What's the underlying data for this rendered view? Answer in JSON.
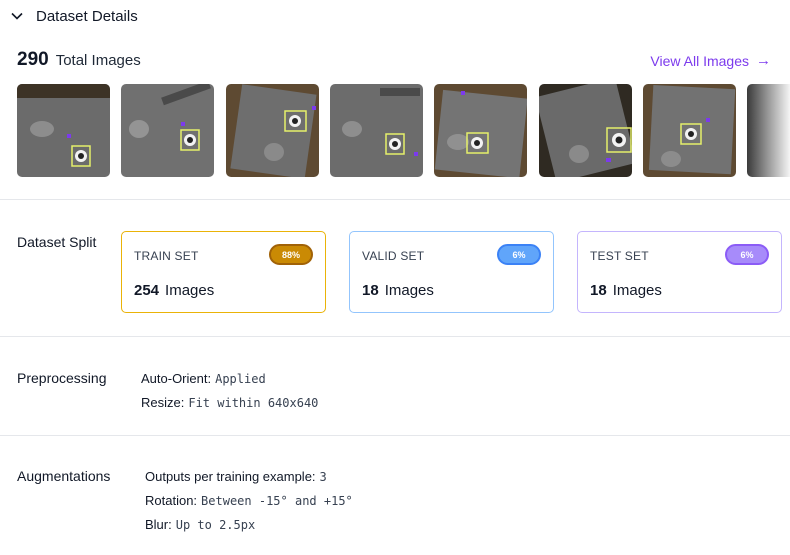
{
  "header": {
    "title": "Dataset Details",
    "icon": "chevron-down-icon"
  },
  "summary": {
    "total_count": "290",
    "total_label": "Total Images",
    "view_all": "View All Images",
    "view_all_arrow": "→"
  },
  "thumbnails": [
    {
      "bg": "#6b6b6b"
    },
    {
      "bg": "#707070"
    },
    {
      "bg": "#6e6e6e"
    },
    {
      "bg": "#6c6c6c"
    },
    {
      "bg": "#747474"
    },
    {
      "bg": "#6a6a6a"
    },
    {
      "bg": "#727272"
    },
    {
      "bg": "#8a8a8a"
    }
  ],
  "split": {
    "label": "Dataset Split",
    "train": {
      "title": "TRAIN SET",
      "badge": "88%",
      "count": "254",
      "unit": "Images"
    },
    "valid": {
      "title": "VALID SET",
      "badge": "6%",
      "count": "18",
      "unit": "Images"
    },
    "test": {
      "title": "TEST SET",
      "badge": "6%",
      "count": "18",
      "unit": "Images"
    }
  },
  "preprocessing": {
    "label": "Preprocessing",
    "items": [
      {
        "key": "Auto-Orient:",
        "value": "Applied"
      },
      {
        "key": "Resize:",
        "value": "Fit within 640x640"
      }
    ]
  },
  "augmentations": {
    "label": "Augmentations",
    "items": [
      {
        "key": "Outputs per training example:",
        "value": "3"
      },
      {
        "key": "Rotation:",
        "value": "Between -15° and +15°"
      },
      {
        "key": "Blur:",
        "value": "Up to 2.5px"
      }
    ]
  },
  "colors": {
    "accent": "#7c3aed",
    "train": "#ca8a04",
    "valid": "#60a5fa",
    "test": "#a78bfa"
  }
}
